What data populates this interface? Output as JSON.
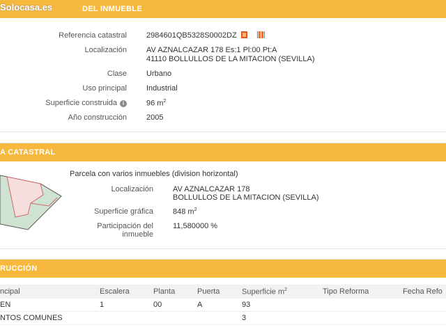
{
  "watermark": "Solocasa.es",
  "inmueble": {
    "header": "DATOS DESCRIPTIVOS DEL INMUEBLE",
    "header_visible": "DEL INMUEBLE",
    "fields": [
      {
        "label": "Referencia catastral",
        "value": "2984601QB5328S0002DZ"
      },
      {
        "label": "Localización",
        "value": "AV AZNALCAZAR 178 Es:1 Pl:00 Pt:A",
        "value2": "41110 BOLLULLOS DE LA MITACION (SEVILLA)"
      },
      {
        "label": "Clase",
        "value": "Urbano"
      },
      {
        "label": "Uso principal",
        "value": "Industrial"
      },
      {
        "label": "Superficie construida",
        "value": "96 m",
        "sup": "2"
      },
      {
        "label": "Año construcción",
        "value": "2005"
      }
    ]
  },
  "parcela": {
    "header": "A CATASTRAL",
    "subtitle": "Parcela con varios inmuebles (division horizontal)",
    "fields": [
      {
        "label": "Localización",
        "value": "AV AZNALCAZAR 178",
        "value2": "BOLLULLOS DE LA MITACION (SEVILLA)"
      },
      {
        "label": "Superficie gráfica",
        "value": "848 m",
        "sup": "2"
      },
      {
        "label": "Participación del",
        "label2": "inmueble",
        "value": "11,580000 %"
      }
    ]
  },
  "construccion": {
    "header": "RUCCIÓN",
    "columns": [
      "ncipal",
      "Escalera",
      "Planta",
      "Puerta",
      "Superficie m",
      "Tipo Reforma",
      "Fecha Refo"
    ],
    "superficie_sup": "2",
    "rows": [
      [
        "EN",
        "1",
        "00",
        "A",
        "93",
        "",
        ""
      ],
      [
        "NTOS COMUNES",
        "",
        "",
        "",
        "3",
        "",
        ""
      ]
    ]
  },
  "colors": {
    "header_orange": "#f7b93d",
    "icon_orange": "#e85a1a"
  }
}
